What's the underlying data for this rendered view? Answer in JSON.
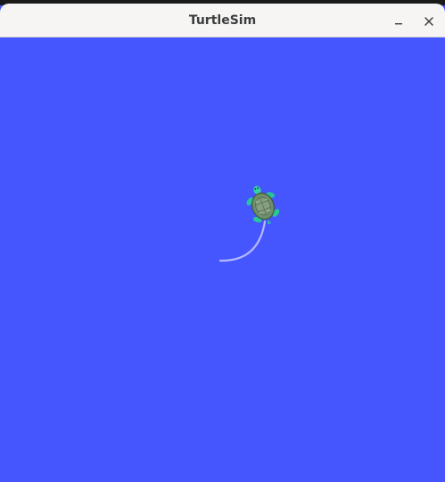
{
  "window": {
    "title": "TurtleSim",
    "controls": [
      "minimize",
      "close"
    ]
  },
  "canvas": {
    "background_color": "#4556ff",
    "pen_color": "#b3b8ff",
    "turtle_icon": "turtle-icon"
  }
}
